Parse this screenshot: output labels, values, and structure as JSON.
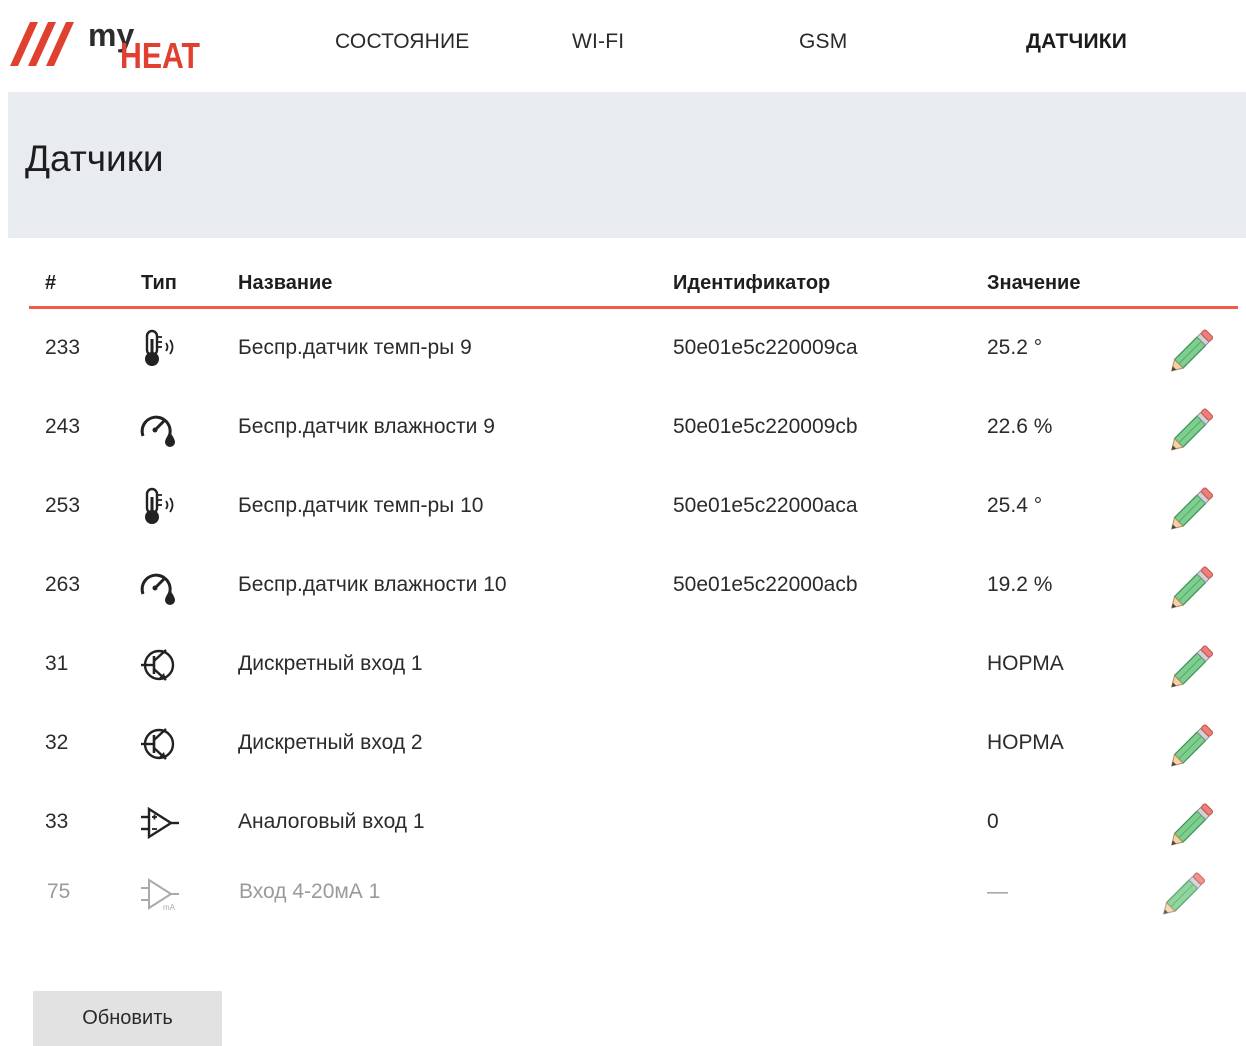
{
  "brand": {
    "logo_text_top": "my",
    "logo_text_bottom": "HEAT"
  },
  "nav": [
    {
      "label": "СОСТОЯНИЕ",
      "active": false
    },
    {
      "label": "WI-FI",
      "active": false
    },
    {
      "label": "GSM",
      "active": false
    },
    {
      "label": "ДАТЧИКИ",
      "active": true
    }
  ],
  "page": {
    "title": "Датчики",
    "refresh_label": "Обновить"
  },
  "colors": {
    "accent": "#ef5b45",
    "banner_bg": "#e8ecf1",
    "pencil_green": "#7ccf8e"
  },
  "table": {
    "headers": {
      "num": "#",
      "type": "Тип",
      "name": "Название",
      "id": "Идентификатор",
      "value": "Значение"
    },
    "rows": [
      {
        "num": "233",
        "type_icon": "thermometer-wireless-icon",
        "name": "Беспр.датчик темп-ры 9",
        "id": "50e01e5c220009ca",
        "value": "25.2 °"
      },
      {
        "num": "243",
        "type_icon": "humidity-gauge-icon",
        "name": "Беспр.датчик влажности 9",
        "id": "50e01e5c220009cb",
        "value": "22.6 %"
      },
      {
        "num": "253",
        "type_icon": "thermometer-wireless-icon",
        "name": "Беспр.датчик темп-ры 10",
        "id": "50e01e5c22000aca",
        "value": "25.4 °"
      },
      {
        "num": "263",
        "type_icon": "humidity-gauge-icon",
        "name": "Беспр.датчик влажности 10",
        "id": "50e01e5c22000acb",
        "value": "19.2 %"
      },
      {
        "num": "31",
        "type_icon": "transistor-icon",
        "name": "Дискретный вход 1",
        "id": "",
        "value": "НОРМА"
      },
      {
        "num": "32",
        "type_icon": "transistor-icon",
        "name": "Дискретный вход 2",
        "id": "",
        "value": "НОРМА"
      },
      {
        "num": "33",
        "type_icon": "amplifier-icon",
        "name": "Аналоговый вход 1",
        "id": "",
        "value": "0"
      },
      {
        "num": "75",
        "type_icon": "current-input-icon",
        "name": "Вход 4-20мА 1",
        "id": "",
        "value": "—",
        "disabled": true
      }
    ]
  }
}
